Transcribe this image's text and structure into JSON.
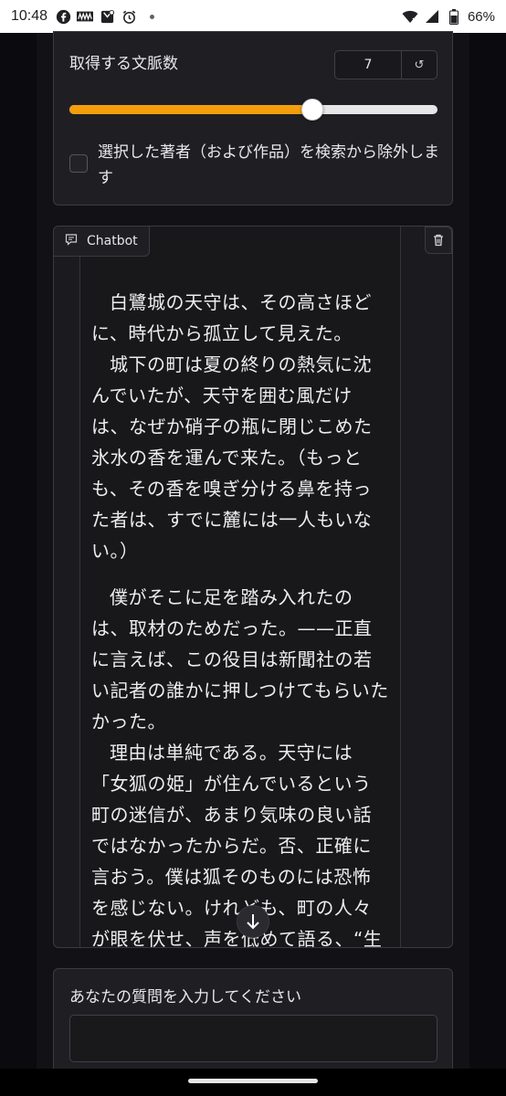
{
  "status_bar": {
    "time": "10:48",
    "icons": [
      "facebook-icon",
      "news-app-icon",
      "tablet-icon",
      "alarm-icon"
    ],
    "battery": "66%"
  },
  "settings": {
    "context_count_label": "取得する文脈数",
    "context_count_value": "7",
    "reset_symbol": "↺",
    "slider_fraction": 0.66,
    "slider_fill_color": "#f59e0b",
    "exclude_label": "選択した著者（および作品）を検索から除外します",
    "exclude_checked": false
  },
  "chatbot": {
    "tab_label": "Chatbot",
    "paragraphs": [
      "白鷺城の天守は、その高さほどに、時代から孤立して見えた。",
      "城下の町は夏の終りの熱気に沈んでいたが、天守を囲む風だけは、なぜか硝子の瓶に閉じこめた氷水の香を運んで来た。（もっとも、その香を嗅ぎ分ける鼻を持った者は、すでに麓には一人もいない。）",
      "僕がそこに足を踏み入れたのは、取材のためだった。——正直に言えば、この役目は新聞社の若い記者の誰かに押しつけてもらいたかった。",
      "理由は単純である。天守には「女狐の姫」が住んでいるという町の迷信が、あまり気味の良い話ではなかったからだ。否、正確に言おう。僕は狐そのものには恐怖を感じない。けれども、町の人々が眼を伏せ、声を低めて語る、“生"
    ]
  },
  "input": {
    "label": "あなたの質問を入力してください",
    "value": ""
  }
}
